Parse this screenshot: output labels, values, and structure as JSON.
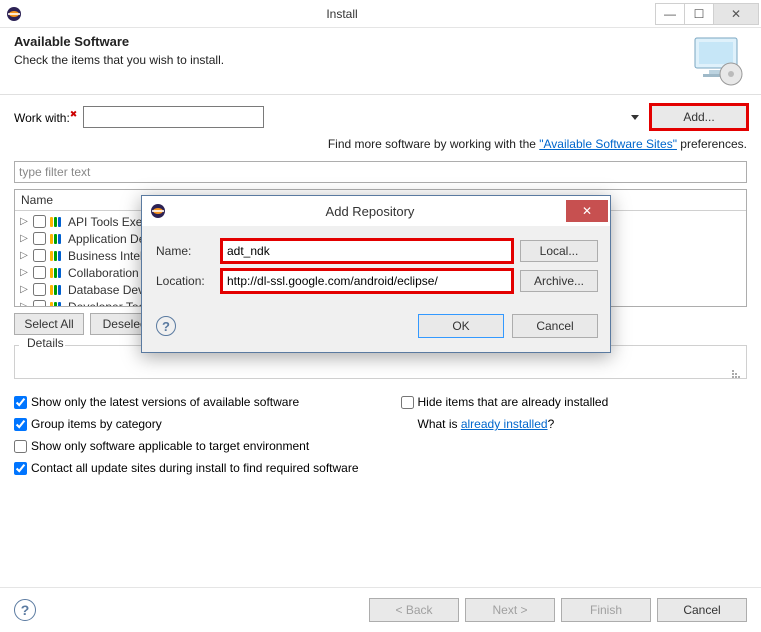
{
  "window": {
    "title": "Install"
  },
  "banner": {
    "heading": "Available Software",
    "subheading": "Check the items that you wish to install."
  },
  "workwith": {
    "label": "Work with:",
    "value": "",
    "add_btn": "Add..."
  },
  "find_more": {
    "prefix": "Find more software by working with the ",
    "link": "\"Available Software Sites\"",
    "suffix": " preferences."
  },
  "filter_placeholder": "type filter text",
  "tree": {
    "header": "Name",
    "items": [
      "API Tools Execution Environment Descriptions",
      "Application Development Frameworks",
      "Business Intelligence, Reporting and Charting",
      "Collaboration",
      "Database Development",
      "Developer Tools"
    ]
  },
  "sel": {
    "select_all": "Select All",
    "deselect_all": "Deselect All"
  },
  "details_label": "Details",
  "opts": {
    "latest": "Show only the latest versions of available software",
    "group": "Group items by category",
    "applicable": "Show only software applicable to target environment",
    "contact": "Contact all update sites during install to find required software",
    "hide": "Hide items that are already installed",
    "what_prefix": "What is ",
    "what_link": "already installed",
    "what_suffix": "?"
  },
  "footer": {
    "back": "< Back",
    "next": "Next >",
    "finish": "Finish",
    "cancel": "Cancel"
  },
  "dialog": {
    "title": "Add Repository",
    "name_label": "Name:",
    "name_value": "adt_ndk",
    "local_btn": "Local...",
    "loc_label": "Location:",
    "loc_value": "http://dl-ssl.google.com/android/eclipse/",
    "archive_btn": "Archive...",
    "ok": "OK",
    "cancel": "Cancel"
  }
}
